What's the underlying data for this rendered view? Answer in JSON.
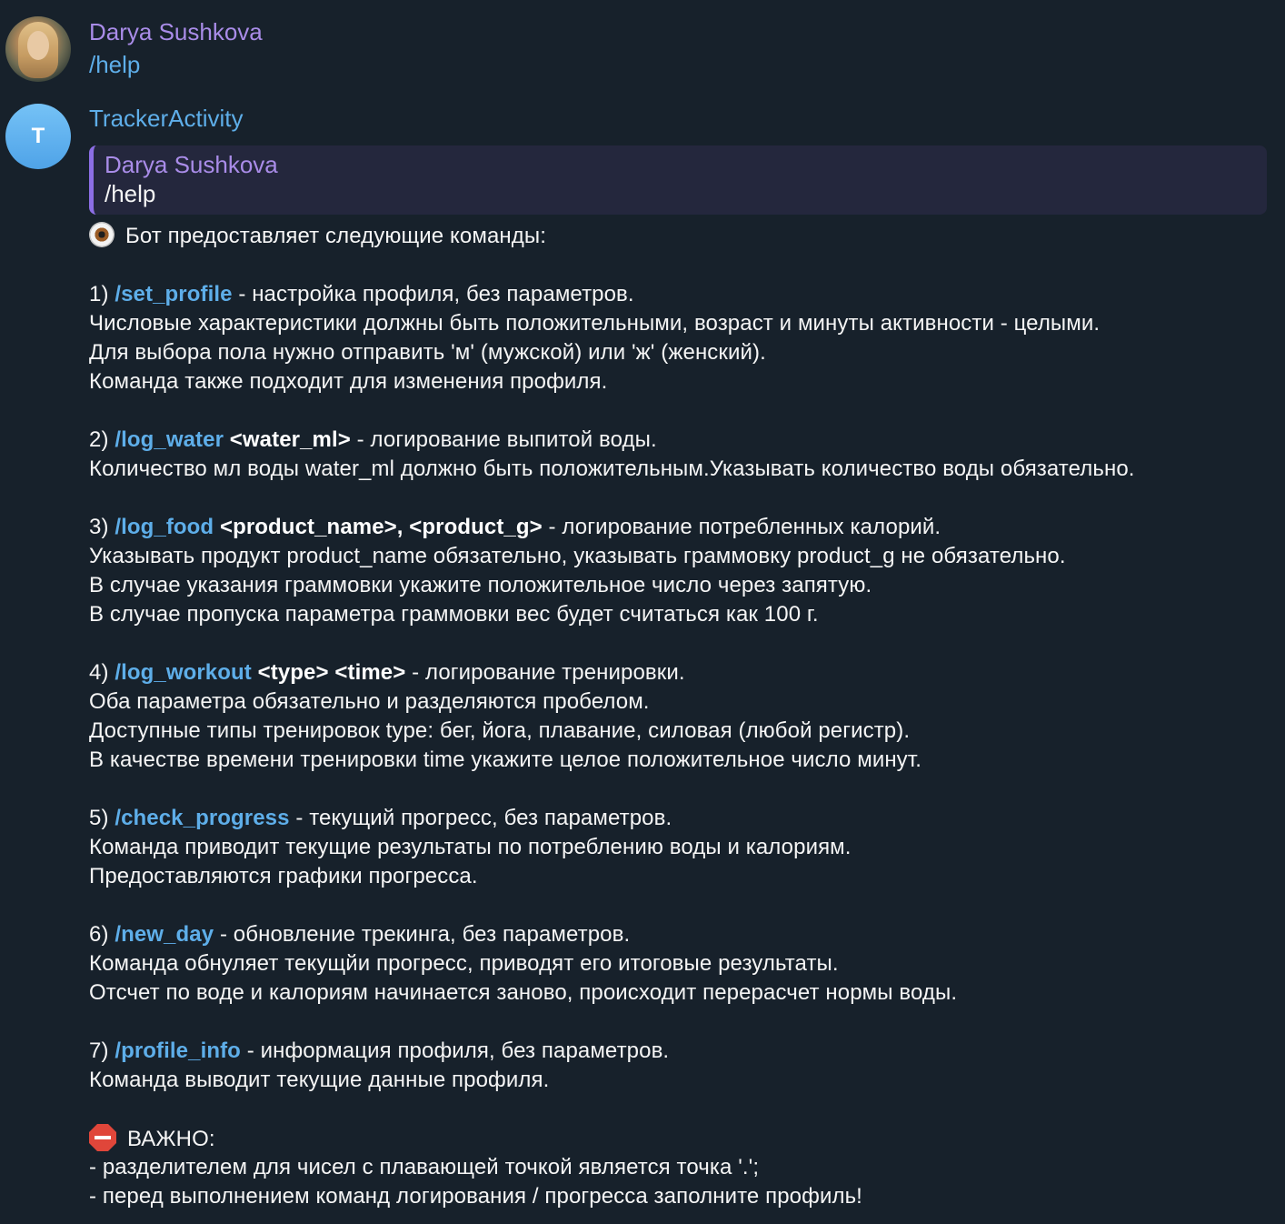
{
  "user_message": {
    "author": "Darya Sushkova",
    "text": "/help"
  },
  "bot_message": {
    "avatar_letter": "T",
    "author": "TrackerActivity",
    "reply_to": {
      "author": "Darya Sushkova",
      "text": "/help"
    },
    "intro": "Бот предоставляет следующие команды:",
    "commands": [
      {
        "number": "1) ",
        "command": "/set_profile",
        "params": "",
        "description": " - настройка профиля, без параметров.",
        "details": [
          "Числовые характеристики должны быть положительными, возраст и минуты активности - целыми.",
          "Для выбора пола нужно отправить 'м' (мужской) или 'ж' (женский).",
          "Команда также подходит для изменения профиля."
        ]
      },
      {
        "number": "2) ",
        "command": "/log_water",
        "params": " <water_ml>",
        "description": " - логирование выпитой воды.",
        "details": [
          "Количество мл воды water_ml должно быть положительным.Указывать количество воды обязательно."
        ]
      },
      {
        "number": "3) ",
        "command": "/log_food",
        "params": " <product_name>, <product_g>",
        "description": " - логирование потребленных калорий.",
        "details": [
          "Указывать продукт product_name обязательно, указывать граммовку product_g не обязательно.",
          "В случае указания граммовки укажите положительное число через запятую.",
          "В случае пропуска параметра граммовки вес будет считаться как 100 г."
        ]
      },
      {
        "number": "4) ",
        "command": "/log_workout",
        "params": " <type> <time>",
        "description": " - логирование тренировки.",
        "details": [
          "Оба параметра обязательно и разделяются пробелом.",
          "Доступные типы тренировок type: бег, йога, плавание, силовая (любой регистр).",
          "В качестве времени тренировки time укажите целое положительное число минут."
        ]
      },
      {
        "number": "5) ",
        "command": "/check_progress",
        "params": "",
        "description": " - текущий прогресс, без параметров.",
        "details": [
          "Команда приводит текущие результаты по потреблению воды и калориям.",
          "Предоставляются графики прогресса."
        ]
      },
      {
        "number": "6) ",
        "command": "/new_day",
        "params": "",
        "description": " - обновление трекинга, без параметров.",
        "details": [
          "Команда обнуляет текущйи прогресс, приводят его итоговые результаты.",
          "Отсчет по воде и калориям начинается заново, происходит перерасчет нормы воды."
        ]
      },
      {
        "number": "7) ",
        "command": "/profile_info",
        "params": "",
        "description": " - информация профиля, без параметров.",
        "details": [
          "Команда выводит текущие данные профиля."
        ]
      }
    ],
    "important_title": "ВАЖНО:",
    "important_notes": [
      "- разделителем для чисел с плавающей точкой является точка '.';",
      "- перед выполнением команд логирования / прогресса заполните профиль!"
    ]
  }
}
